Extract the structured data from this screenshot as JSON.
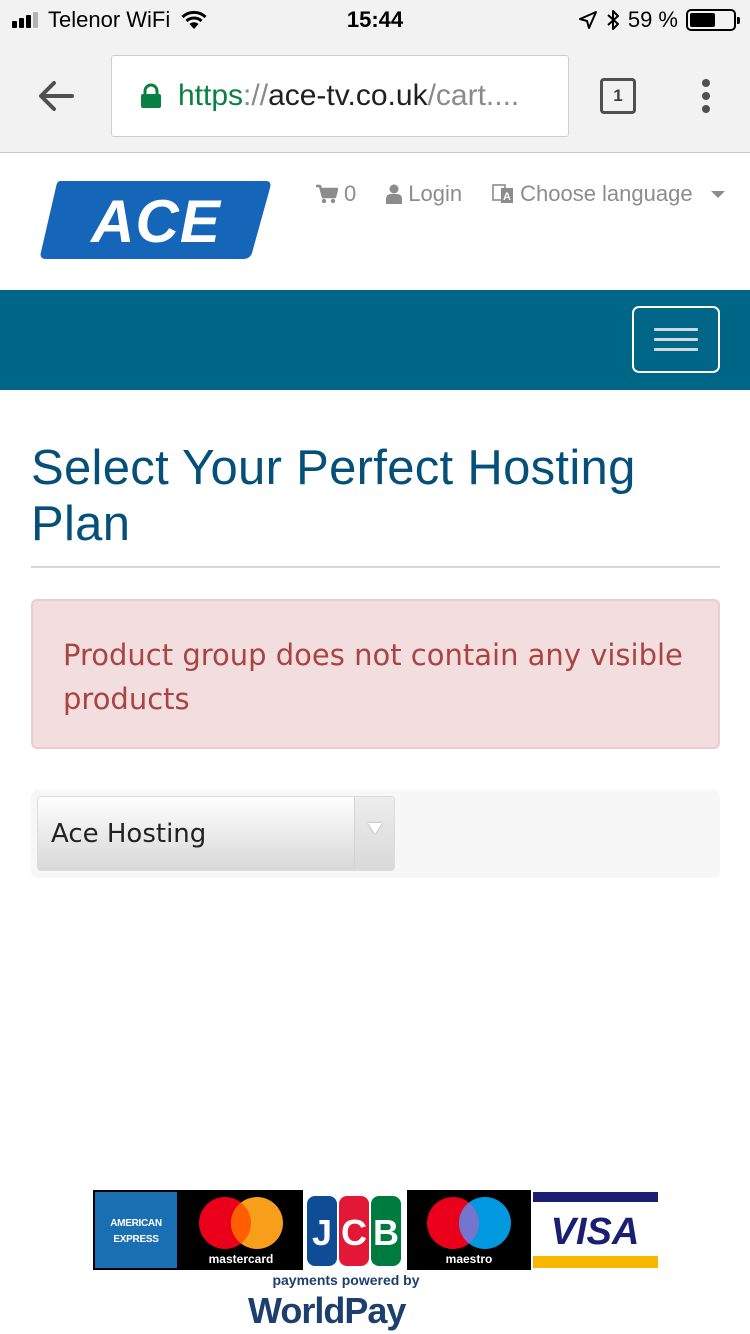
{
  "status_bar": {
    "carrier": "Telenor WiFi",
    "time": "15:44",
    "battery_percent": "59 %",
    "battery_level": 0.59,
    "signal_bars": 3,
    "signal_bars_total": 4
  },
  "browser": {
    "url_scheme": "https",
    "url_separator": "://",
    "url_host": "ace-tv.co.uk",
    "url_path": "/cart....",
    "tab_count": "1"
  },
  "header": {
    "logo_text": "ACE",
    "cart_count": "0",
    "login_label": "Login",
    "language_label": "Choose language"
  },
  "main": {
    "title": "Select Your Perfect Hosting Plan",
    "alert_message": "Product group does not contain any visible products",
    "product_group_select": {
      "selected": "Ace Hosting"
    }
  },
  "footer": {
    "payment_methods": [
      "AMERICAN EXPRESS",
      "mastercard",
      "JCB",
      "maestro",
      "VISA"
    ],
    "powered_by": "payments powered by",
    "powered_by_brand": "WorldPay"
  },
  "colors": {
    "nav_bar": "#006688",
    "title": "#05507a",
    "alert_bg": "#f2dede",
    "alert_text": "#a94442",
    "url_secure": "#0b8043"
  }
}
